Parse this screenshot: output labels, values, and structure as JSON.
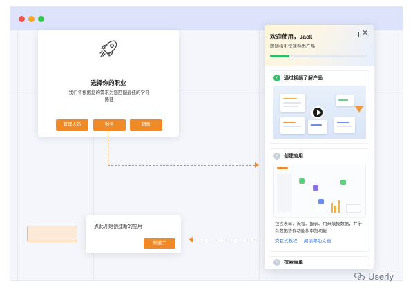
{
  "job_card": {
    "title": "选择你的职业",
    "description": "我们将根据您的需求为您匹配最佳的学习路径",
    "options": [
      {
        "label": "管理人员"
      },
      {
        "label": "财务"
      },
      {
        "label": "销售"
      }
    ]
  },
  "hint_card": {
    "text": "点此开始创建新的应用",
    "button_label": "知道了"
  },
  "onboarding_panel": {
    "welcome": "欢迎使用，Jack",
    "subtitle": "跟随指引快速熟悉产品",
    "progress_fraction": 0.2,
    "steps": [
      {
        "title": "通过视频了解产品",
        "status": "done"
      },
      {
        "title": "创建应用",
        "status": "todo",
        "description": "包含表单、流程、报表、用来填报数据，并带有数据协作功能和审批功能",
        "links": [
          "交互式教程",
          "阅读帮助文档"
        ]
      },
      {
        "title": "探索表单",
        "status": "todo"
      }
    ]
  },
  "watermark": {
    "text": "Userly"
  },
  "colors": {
    "accent": "#ef8a26",
    "success": "#2fbf6b",
    "link": "#2f6fe0"
  }
}
